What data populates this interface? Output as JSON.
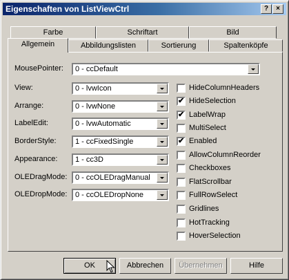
{
  "window": {
    "title": "Eigenschaften von ListViewCtrl",
    "help_label": "?",
    "close_label": "×"
  },
  "tabs_back": [
    {
      "label": "Farbe"
    },
    {
      "label": "Schriftart"
    },
    {
      "label": "Bild"
    }
  ],
  "tabs_front": [
    {
      "label": "Allgemein",
      "active": true
    },
    {
      "label": "Abbildungslisten"
    },
    {
      "label": "Sortierung"
    },
    {
      "label": "Spaltenköpfe"
    }
  ],
  "props": {
    "mousepointer": {
      "label": "MousePointer:",
      "value": "0 - ccDefault"
    },
    "view": {
      "label": "View:",
      "value": "0 - lvwIcon"
    },
    "arrange": {
      "label": "Arrange:",
      "value": "0 - lvwNone"
    },
    "labeledit": {
      "label": "LabelEdit:",
      "value": "0 - lvwAutomatic"
    },
    "borderstyle": {
      "label": "BorderStyle:",
      "value": "1 - ccFixedSingle"
    },
    "appearance": {
      "label": "Appearance:",
      "value": "1 - cc3D"
    },
    "oledragmode": {
      "label": "OLEDragMode:",
      "value": "0 - ccOLEDragManual"
    },
    "oledropmode": {
      "label": "OLEDropMode:",
      "value": "0 - ccOLEDropNone"
    }
  },
  "checkboxes": [
    {
      "label": "HideColumnHeaders",
      "checked": false
    },
    {
      "label": "HideSelection",
      "checked": true
    },
    {
      "label": "LabelWrap",
      "checked": true
    },
    {
      "label": "MultiSelect",
      "checked": false
    },
    {
      "label": "Enabled",
      "checked": true
    },
    {
      "label": "AllowColumnReorder",
      "checked": false
    },
    {
      "label": "Checkboxes",
      "checked": false
    },
    {
      "label": "FlatScrollbar",
      "checked": false
    },
    {
      "label": "FullRowSelect",
      "checked": false
    },
    {
      "label": "Gridlines",
      "checked": false
    },
    {
      "label": "HotTracking",
      "checked": false
    },
    {
      "label": "HoverSelection",
      "checked": false
    }
  ],
  "checkmark": "✔",
  "buttons": {
    "ok": "OK",
    "cancel": "Abbrechen",
    "apply": "Übernehmen",
    "help": "Hilfe"
  }
}
